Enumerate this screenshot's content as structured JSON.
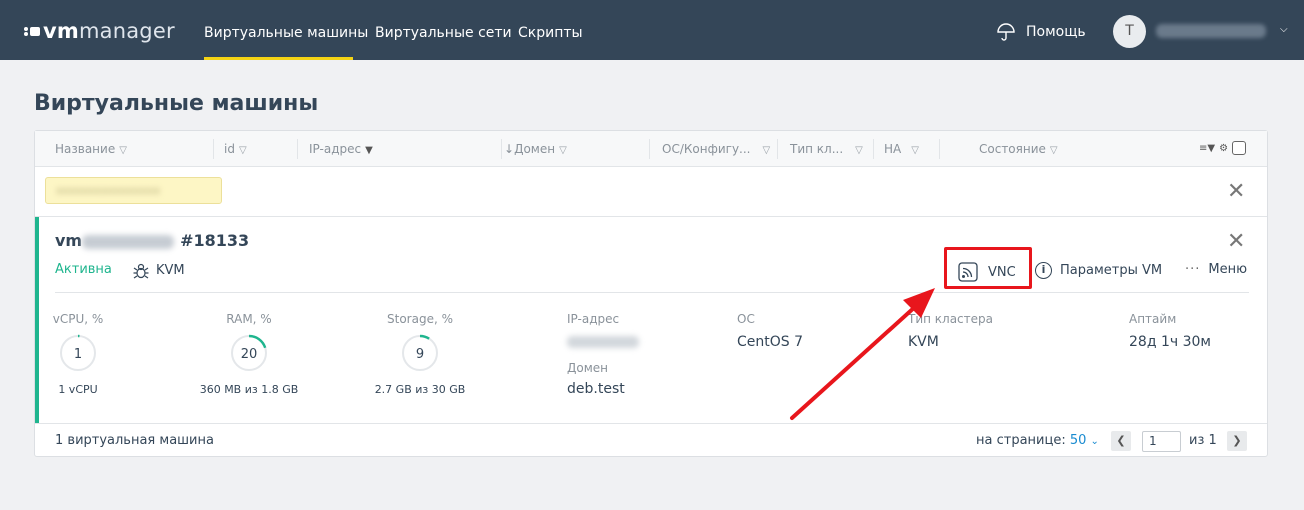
{
  "nav": {
    "logo_vm": "vm",
    "logo_manager": "manager",
    "items": [
      {
        "label": "Виртуальные машины",
        "active": true
      },
      {
        "label": "Виртуальные сети",
        "active": false
      },
      {
        "label": "Скрипты",
        "active": false
      }
    ],
    "help_label": "Помощь",
    "avatar_letter": "T"
  },
  "page": {
    "title": "Виртуальные машины"
  },
  "table": {
    "columns": [
      "Название",
      "id",
      "IP-адрес",
      "Домен",
      "ОС/Конфигу...",
      "Тип кл...",
      "HA",
      "Состояние"
    ],
    "sort_indicator": "↓",
    "active_filter_column": "IP-адрес"
  },
  "vm": {
    "name_prefix": "vm",
    "id_label": "#18133",
    "status": "Активна",
    "hypervisor": "KVM",
    "actions": {
      "vnc": "VNC",
      "params": "Параметры VM",
      "menu": "Меню"
    },
    "metrics": [
      {
        "label": "vCPU, %",
        "value": "1",
        "percent": 1,
        "sub": "1 vCPU"
      },
      {
        "label": "RAM, %",
        "value": "20",
        "percent": 20,
        "sub": "360 MB из 1.8 GB"
      },
      {
        "label": "Storage, %",
        "value": "9",
        "percent": 9,
        "sub": "2.7 GB из 30 GB"
      }
    ],
    "ip_label": "IP-адрес",
    "domain_label": "Домен",
    "domain": "deb.test",
    "os_label": "ОС",
    "os": "CentOS 7",
    "cluster_label": "Тип кластера",
    "cluster": "KVM",
    "uptime_label": "Аптайм",
    "uptime": "28д 1ч 30м"
  },
  "footer": {
    "count": "1 виртуальная машина",
    "per_page_label": "на странице:",
    "per_page": "50",
    "page": "1",
    "of_label": "из",
    "total_pages": "1"
  },
  "colors": {
    "nav_bg": "#344658",
    "nav_active_underline": "#f5d414",
    "status_active": "#1fb58e",
    "highlight_box": "#e8161c",
    "link": "#1a8bd0"
  }
}
